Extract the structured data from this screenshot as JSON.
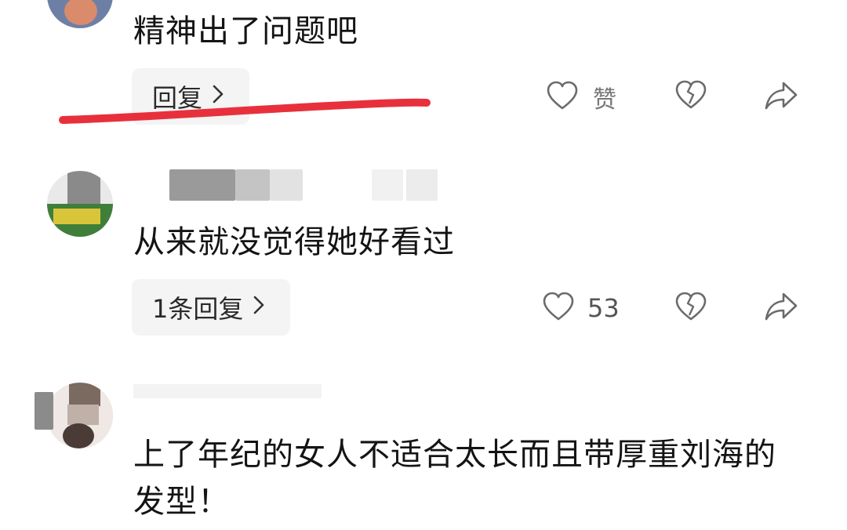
{
  "comments": [
    {
      "text": "精神出了问题吧",
      "reply_label": "回复",
      "like_label": "赞"
    },
    {
      "text": "从来就没觉得她好看过",
      "reply_label": "1条回复",
      "like_count": "53"
    },
    {
      "text": "上了年纪的女人不适合太长而且带厚重刘海的发型！"
    }
  ],
  "icons": {
    "like": "heart-outline-icon",
    "dislike": "broken-heart-icon",
    "share": "share-arrow-icon",
    "reply_chevron": "chevron-right-icon"
  },
  "colors": {
    "annotation_underline": "#e8303c",
    "chip_bg": "#f4f4f4",
    "icon_stroke": "#6b6b6b"
  }
}
